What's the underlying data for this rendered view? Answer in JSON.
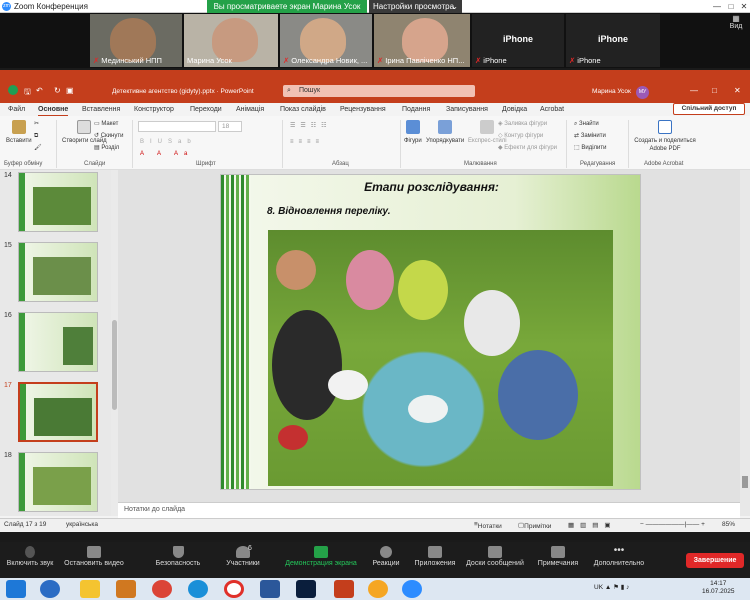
{
  "zoom": {
    "window_title": "Zoom Конференция",
    "sharing_banner": "Вы просматриваете экран Марина Усок",
    "view_settings": "Настройки просмотра",
    "view_button": "Вид",
    "participants": [
      {
        "name": "Мединський НПП",
        "muted": true
      },
      {
        "name": "Марина Усок",
        "muted": false
      },
      {
        "name": "Олександра Новик, ...",
        "muted": true
      },
      {
        "name": "Ірина Павліченко НП...",
        "muted": true
      },
      {
        "name": "iPhone",
        "big_label": "iPhone",
        "muted": true
      },
      {
        "name": "iPhone",
        "big_label": "iPhone",
        "muted": true
      }
    ],
    "toolbar": {
      "mute": "Включить звук",
      "video": "Остановить видео",
      "security": "Безопасность",
      "participants": "Участники",
      "participants_count": "6",
      "share": "Демонстрация экрана",
      "reactions": "Реакции",
      "apps": "Приложения",
      "whiteboard": "Доски сообщений",
      "notes": "Примечания",
      "more": "Дополнительно",
      "end": "Завершение"
    }
  },
  "ppt": {
    "doc_title": "Детективне агентство (gidyty).pptx  ·  PowerPoint",
    "search_placeholder": "Пошук",
    "user_name": "Марина Усок",
    "user_initials": "МУ",
    "tabs": [
      "Файл",
      "Основне",
      "Вставлення",
      "Конструктор",
      "Переходи",
      "Анімація",
      "Показ слайдів",
      "Рецензування",
      "Подання",
      "Записування",
      "Довідка",
      "Acrobat"
    ],
    "selected_tab": "Основне",
    "share_button": "Спільний доступ",
    "ribbon": {
      "paste": "Вставити",
      "clipboard_group": "Буфер обміну",
      "new_slide": "Створити слайд",
      "layout": "Макет",
      "reset": "Скинути",
      "section": "Розділ",
      "slides_group": "Слайди",
      "font_group": "Шрифт",
      "paragraph_group": "Абзац",
      "shapes": "Фігури",
      "arrange": "Упорядкувати",
      "quick_styles": "Експрес-стилі",
      "fill": "Заливка фігури",
      "outline": "Контур фігури",
      "effects": "Ефекти для фігури",
      "drawing_group": "Малювання",
      "find": "Знайти",
      "replace": "Замінити",
      "select": "Виділити",
      "editing_group": "Редагування",
      "adobe": "Создать и поделиться Adobe PDF",
      "adobe_group": "Adobe Acrobat",
      "font_size": "18"
    },
    "thumbnails": [
      {
        "num": "14"
      },
      {
        "num": "15"
      },
      {
        "num": "16"
      },
      {
        "num": "17",
        "selected": true
      },
      {
        "num": "18"
      }
    ],
    "slide": {
      "title": "Етапи розслідування:",
      "subtitle": "8. Відновлення переліку."
    },
    "notes_placeholder": "Нотатки до слайда",
    "status": {
      "slide_of": "Слайд 17 з 19",
      "language": "українська",
      "notes": "Нотатки",
      "comments": "Примітки",
      "zoom": "85%"
    }
  },
  "taskbar": {
    "lang": "UK",
    "time": "14:17",
    "date": "16.07.2025"
  }
}
